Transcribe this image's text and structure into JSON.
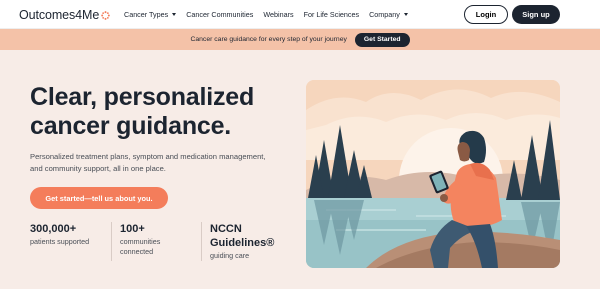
{
  "nav": {
    "logo": "Outcomes4Me",
    "items": [
      {
        "label": "Cancer Types",
        "has_dropdown": true
      },
      {
        "label": "Cancer Communities",
        "has_dropdown": false
      },
      {
        "label": "Webinars",
        "has_dropdown": false
      },
      {
        "label": "For Life Sciences",
        "has_dropdown": false
      },
      {
        "label": "Company",
        "has_dropdown": true
      }
    ],
    "login_label": "Login",
    "signup_label": "Sign up"
  },
  "banner": {
    "text": "Cancer care guidance for every step of your journey",
    "button_label": "Get Started"
  },
  "hero": {
    "headline_line1": "Clear, personalized",
    "headline_line2": "cancer guidance.",
    "subtext": "Personalized treatment plans, symptom and medication management, and community support, all in one place.",
    "cta_label": "Get started—tell us about you."
  },
  "stats": [
    {
      "value": "300,000+",
      "label": "patients supported"
    },
    {
      "value": "100+",
      "label": "communities connected"
    },
    {
      "value": "NCCN Guidelines®",
      "label": "guiding care"
    }
  ],
  "colors": {
    "accent": "#f47d5b",
    "dark": "#1c2430",
    "banner": "#f4c2a8",
    "background": "#f7ece7"
  }
}
